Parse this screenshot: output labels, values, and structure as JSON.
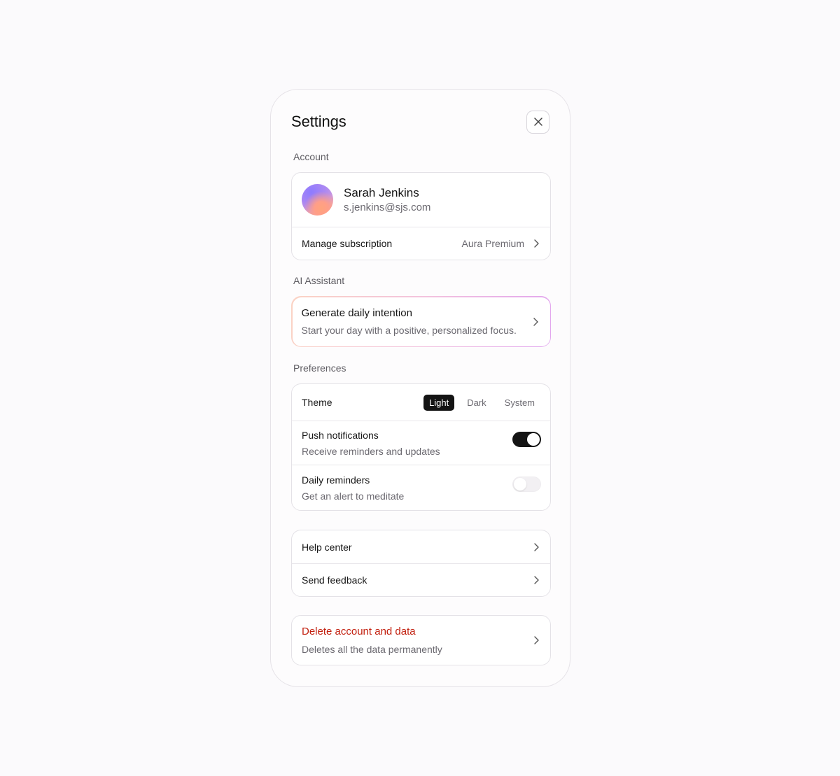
{
  "header": {
    "title": "Settings"
  },
  "account": {
    "section_label": "Account",
    "name": "Sarah Jenkins",
    "email": "s.jenkins@sjs.com",
    "subscription_label": "Manage subscription",
    "subscription_value": "Aura Premium"
  },
  "ai": {
    "section_label": "AI Assistant",
    "title": "Generate daily intention",
    "subtitle": "Start your day with a positive, personalized focus."
  },
  "preferences": {
    "section_label": "Preferences",
    "theme_label": "Theme",
    "theme_options": [
      "Light",
      "Dark",
      "System"
    ],
    "theme_selected": "Light",
    "push_title": "Push notifications",
    "push_sub": "Receive reminders and updates",
    "push_on": true,
    "daily_title": "Daily reminders",
    "daily_sub": "Get an alert to meditate",
    "daily_on": false
  },
  "support": {
    "help_label": "Help center",
    "feedback_label": "Send feedback"
  },
  "danger": {
    "title": "Delete account and data",
    "subtitle": "Deletes all the data permanently",
    "color": "#c2200f"
  }
}
